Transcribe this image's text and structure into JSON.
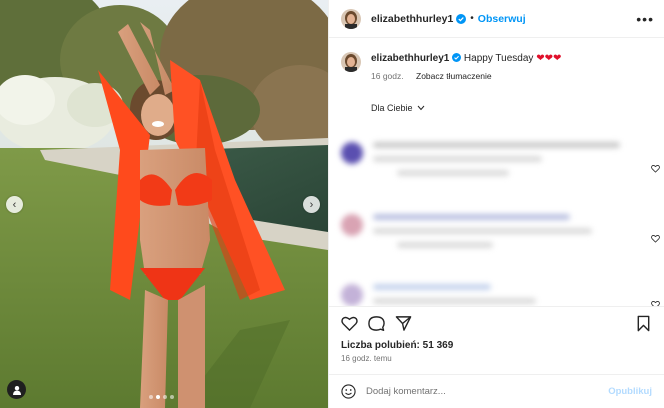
{
  "post": {
    "username": "elizabethhurley1",
    "follow_label": "Obserwuj",
    "header_separator": "•",
    "more_icon": "more-horizontal-icon"
  },
  "caption": {
    "username": "elizabethhurley1",
    "text": "Happy Tuesday",
    "hearts": "❤❤❤",
    "time": "16 godz.",
    "translate_label": "Zobacz tłumaczenie"
  },
  "comments": {
    "sort_label": "Dla Ciebie",
    "blurred": true
  },
  "carousel": {
    "slide_count": 4,
    "active_index": 1
  },
  "stats": {
    "likes_label": "Liczba polubień:",
    "likes_value": "51 369",
    "time_ago": "16 godz. temu"
  },
  "composer": {
    "placeholder": "Dodaj komentarz...",
    "post_label": "Opublikuj"
  },
  "colors": {
    "accent": "#0095f6",
    "heart_red": "#e0102b",
    "dress": "#ff4a1c",
    "grass": "#6d8a3a"
  }
}
